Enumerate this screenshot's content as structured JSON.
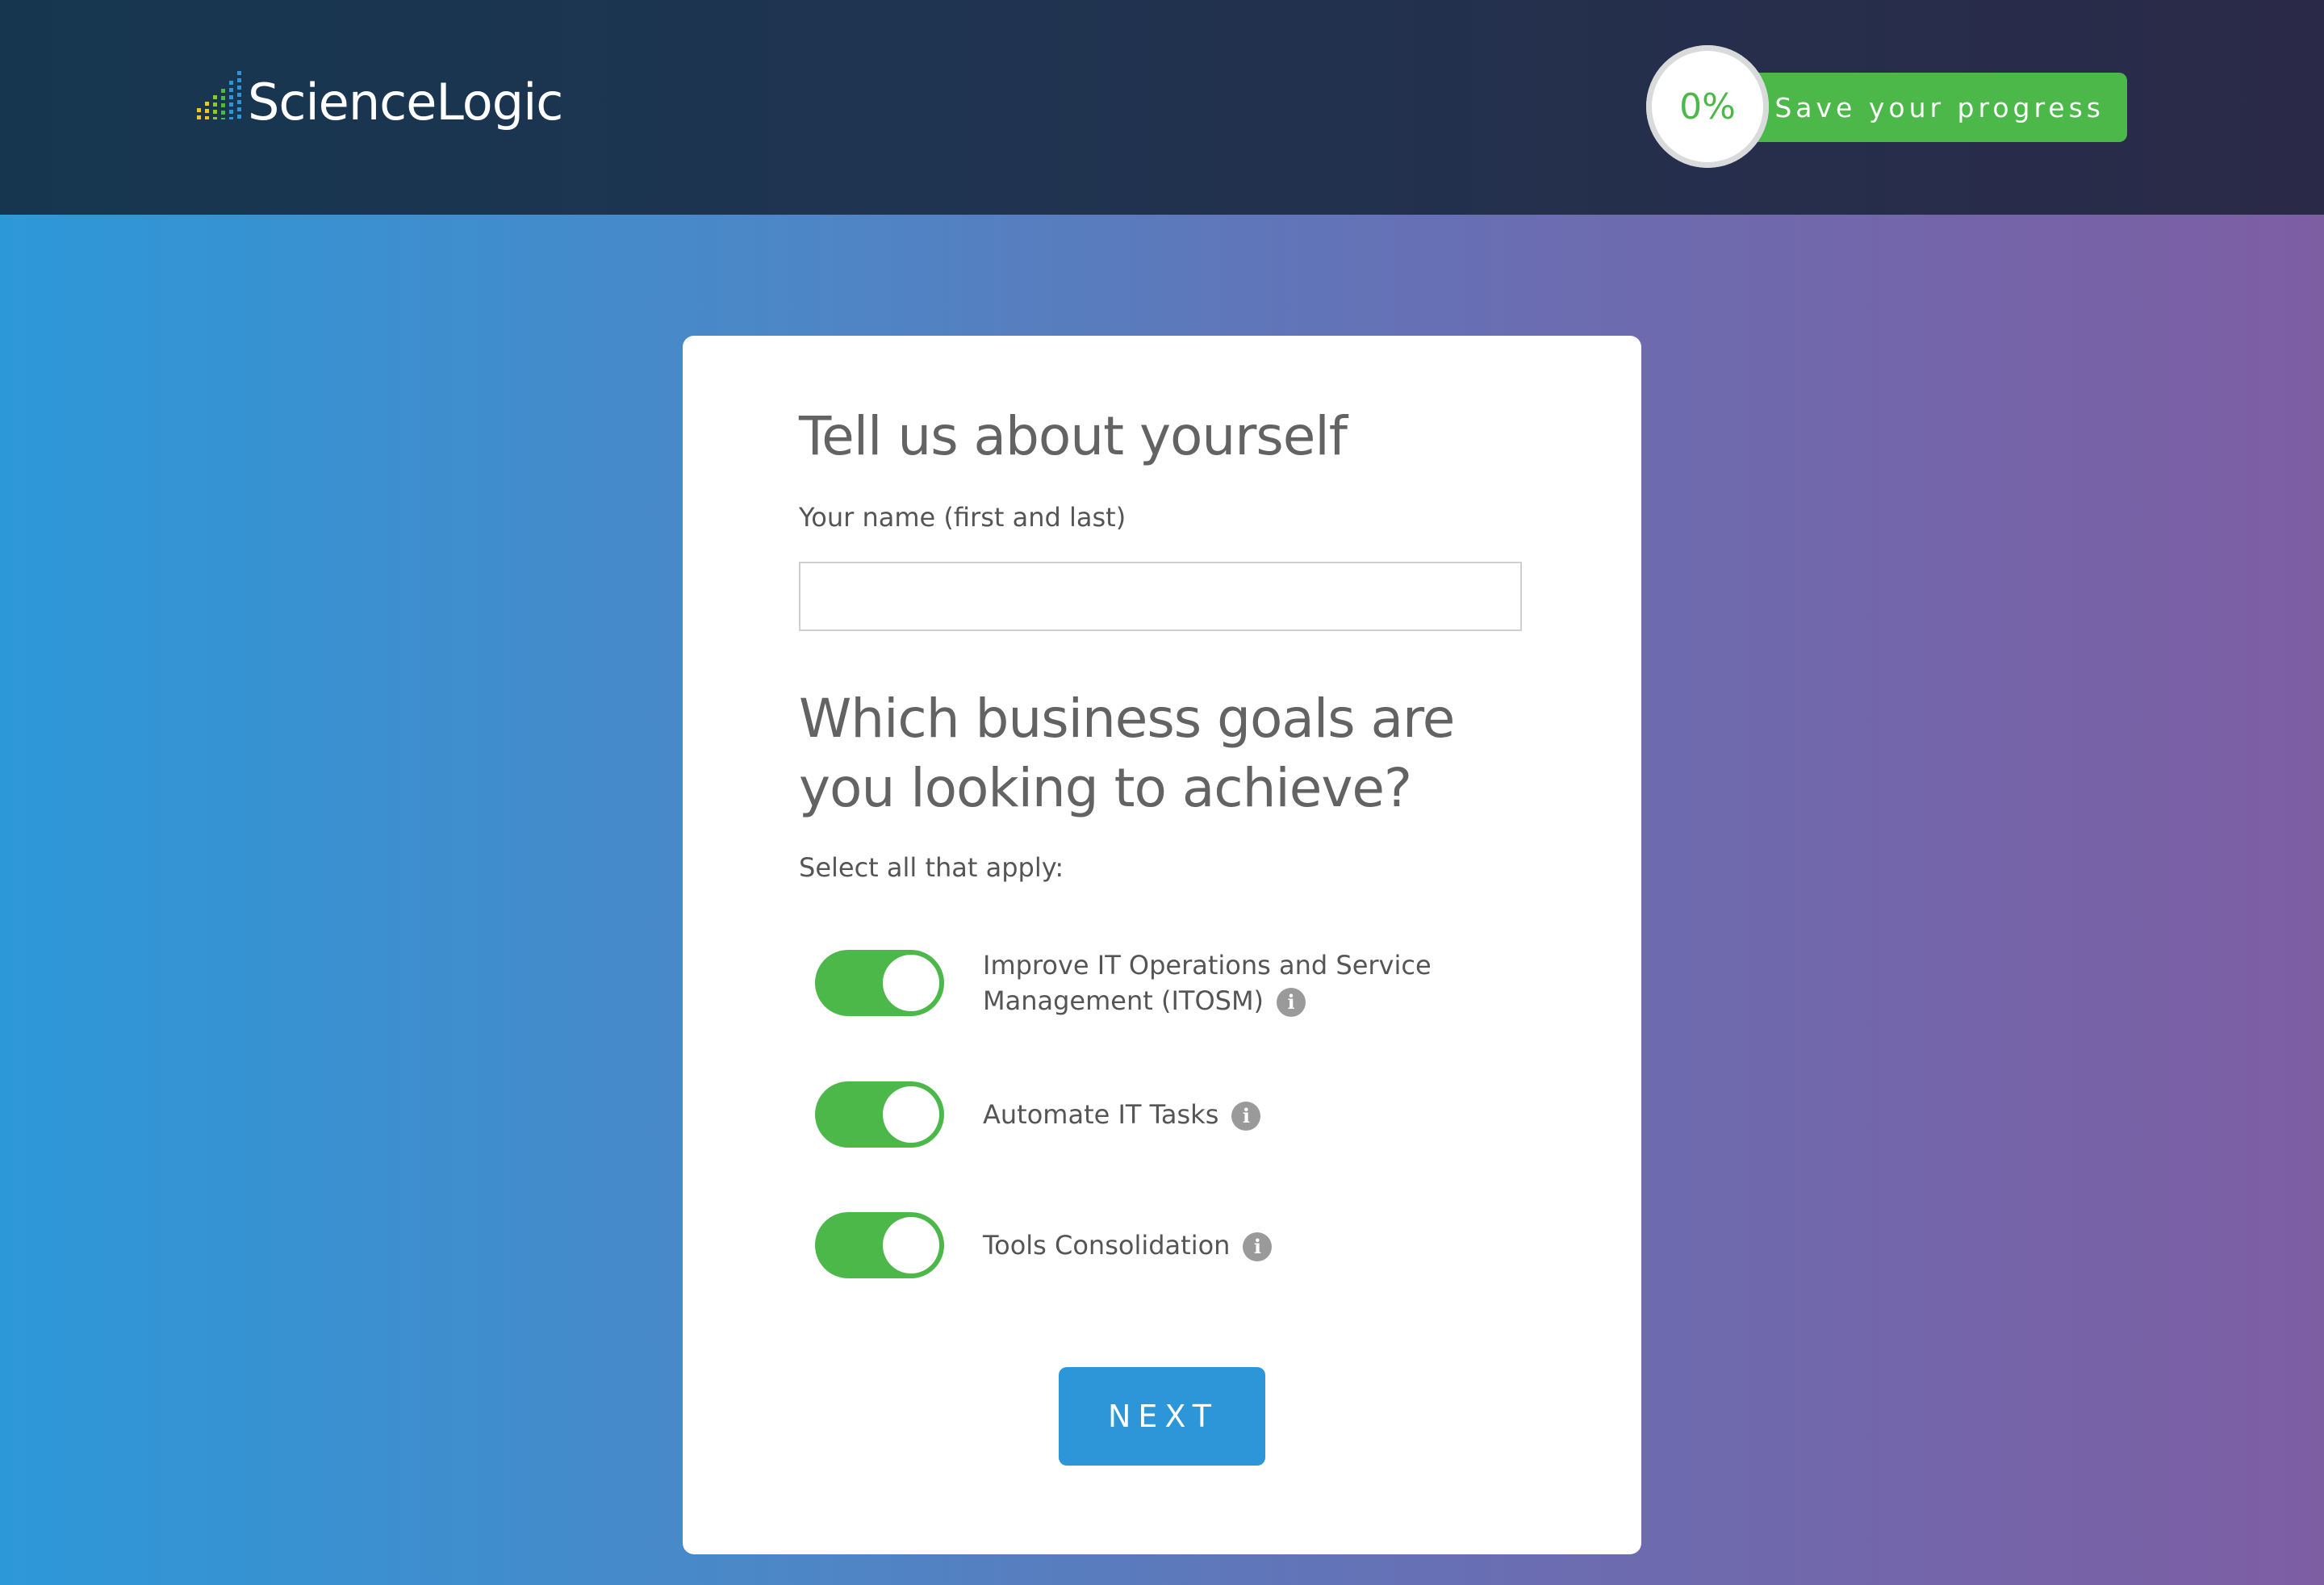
{
  "header": {
    "logo_text": "ScienceLogic",
    "progress_percent": "0%",
    "save_label": "Save your progress"
  },
  "form": {
    "title": "Tell us about yourself",
    "name_label": "Your name (first and last)",
    "name_value": "",
    "goals_title": "Which business goals are you looking to achieve?",
    "select_hint": "Select all that apply:",
    "goals": [
      {
        "label": "Improve IT Operations and Service Management (ITOSM)",
        "checked": true
      },
      {
        "label": "Automate IT Tasks",
        "checked": true
      },
      {
        "label": "Tools Consolidation",
        "checked": true
      }
    ],
    "next_label": "NEXT"
  },
  "colors": {
    "accent_green": "#4db84a",
    "button_blue": "#2d96d9"
  },
  "icons": [
    "logo-bars-icon",
    "info-icon"
  ]
}
